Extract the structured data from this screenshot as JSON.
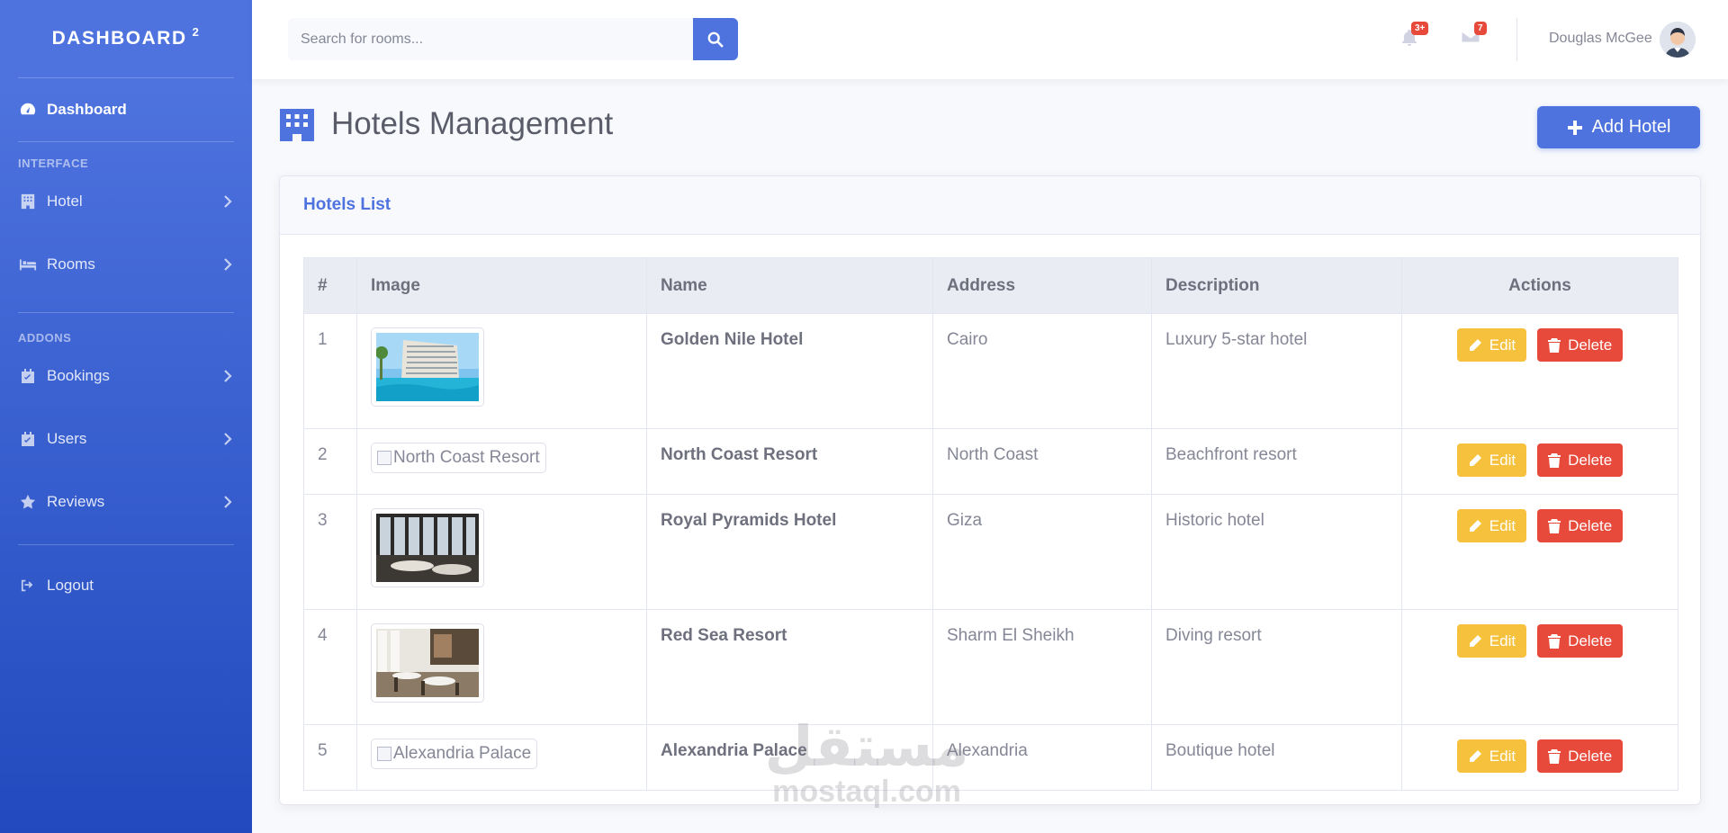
{
  "sidebar": {
    "brand": "DASHBOARD",
    "brand_sup": "2",
    "dashboard_label": "Dashboard",
    "section_interface": "INTERFACE",
    "hotel_label": "Hotel",
    "rooms_label": "Rooms",
    "section_addons": "ADDONS",
    "bookings_label": "Bookings",
    "users_label": "Users",
    "reviews_label": "Reviews",
    "logout_label": "Logout"
  },
  "topbar": {
    "search_placeholder": "Search for rooms...",
    "alerts_badge": "3+",
    "messages_badge": "7",
    "user_name": "Douglas McGee"
  },
  "page": {
    "title": "Hotels Management",
    "add_button": "Add Hotel"
  },
  "card": {
    "title": "Hotels List"
  },
  "table": {
    "headers": {
      "num": "#",
      "image": "Image",
      "name": "Name",
      "address": "Address",
      "description": "Description",
      "actions": "Actions"
    },
    "edit_label": "Edit",
    "delete_label": "Delete",
    "rows": [
      {
        "num": "1",
        "name": "Golden Nile Hotel",
        "address": "Cairo",
        "description": "Luxury 5-star hotel",
        "image_alt": ""
      },
      {
        "num": "2",
        "name": "North Coast Resort",
        "address": "North Coast",
        "description": "Beachfront resort",
        "image_alt": "North Coast Resort"
      },
      {
        "num": "3",
        "name": "Royal Pyramids Hotel",
        "address": "Giza",
        "description": "Historic hotel",
        "image_alt": ""
      },
      {
        "num": "4",
        "name": "Red Sea Resort",
        "address": "Sharm El Sheikh",
        "description": "Diving resort",
        "image_alt": ""
      },
      {
        "num": "5",
        "name": "Alexandria Palace",
        "address": "Alexandria",
        "description": "Boutique hotel",
        "image_alt": "Alexandria Palace"
      }
    ]
  },
  "watermark": {
    "arabic": "مستقل",
    "latin": "mostaql.com"
  },
  "colors": {
    "primary": "#4e73df",
    "warning": "#f6c23e",
    "danger": "#e74a3b"
  }
}
